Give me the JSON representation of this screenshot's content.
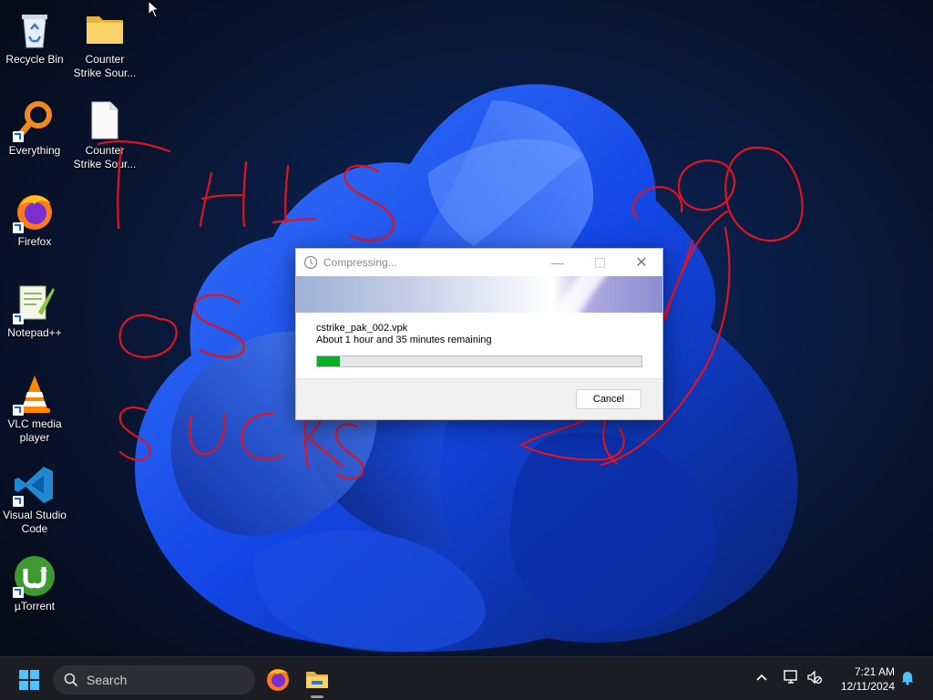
{
  "desktop": {
    "icons": [
      {
        "label": "Recycle Bin",
        "icon": "recycle-bin-icon",
        "shortcut": false
      },
      {
        "label": "Counter Strike Sour...",
        "icon": "folder-icon",
        "shortcut": false
      },
      {
        "label": "Everything",
        "icon": "everything-icon",
        "shortcut": true
      },
      {
        "label": "Counter Strike Sour...",
        "icon": "file-icon",
        "shortcut": false
      },
      {
        "label": "Firefox",
        "icon": "firefox-icon",
        "shortcut": true
      },
      {
        "label": "Notepad++",
        "icon": "notepadpp-icon",
        "shortcut": true
      },
      {
        "label": "VLC media player",
        "icon": "vlc-icon",
        "shortcut": true
      },
      {
        "label": "Visual Studio Code",
        "icon": "vscode-icon",
        "shortcut": true
      },
      {
        "label": "µTorrent",
        "icon": "utorrent-icon",
        "shortcut": true
      }
    ]
  },
  "dialog": {
    "title": "Compressing...",
    "filename": "cstrike_pak_002.vpk",
    "time_remaining": "About 1 hour and 35 minutes remaining",
    "progress_fraction": 0.07,
    "cancel_label": "Cancel"
  },
  "taskbar": {
    "search_label": "Search",
    "time": "7:21 AM",
    "date": "12/11/2024"
  },
  "colors": {
    "progress_fill": "#06b025",
    "scribble": "#e0141e",
    "taskbar_bg": "#1c1d22"
  }
}
